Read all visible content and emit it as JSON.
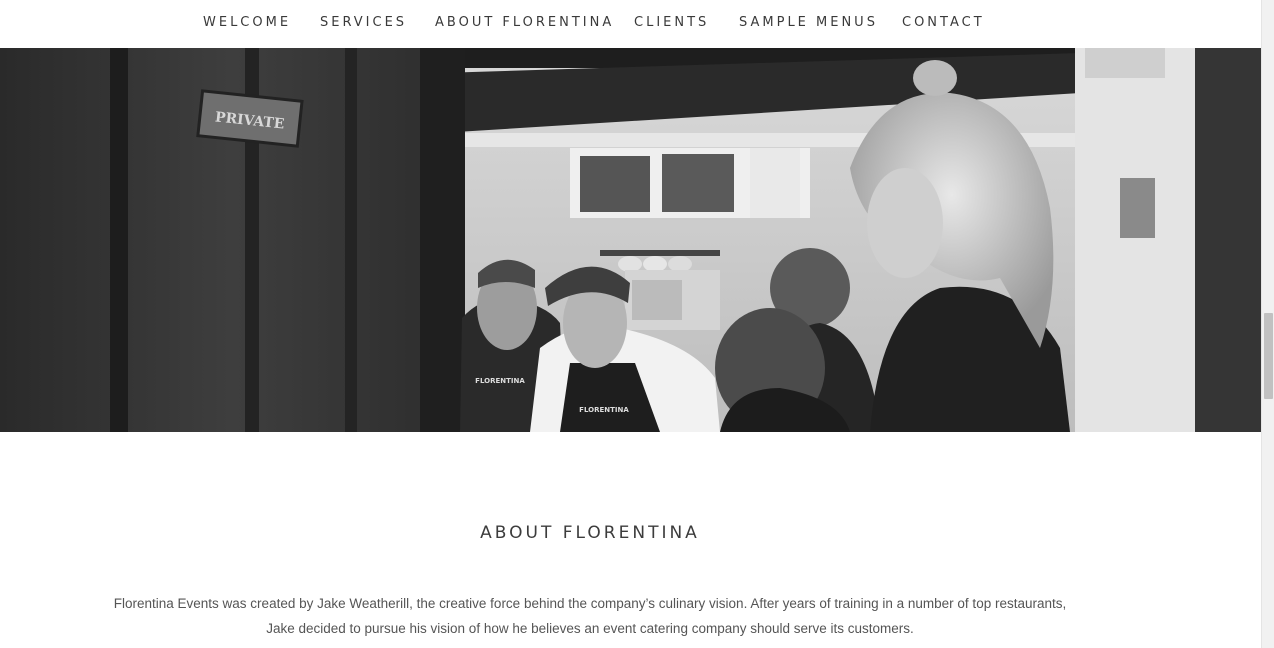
{
  "nav": {
    "items": [
      {
        "label": "WELCOME"
      },
      {
        "label": "SERVICES"
      },
      {
        "label": "ABOUT FLORENTINA"
      },
      {
        "label": "CLIENTS"
      },
      {
        "label": "SAMPLE MENUS"
      },
      {
        "label": "CONTACT"
      }
    ]
  },
  "hero": {
    "door_sign": "PRIVATE",
    "apron_text_left": "FLORENTINA",
    "apron_text_center": "FLORENTINA"
  },
  "about": {
    "title": "ABOUT FLORENTINA",
    "paragraph": "Florentina Events was created by Jake Weatherill, the creative force behind the company’s culinary vision. After years of training in a number of top restaurants, Jake decided to pursue his vision of how he believes an event catering company should serve its customers."
  }
}
